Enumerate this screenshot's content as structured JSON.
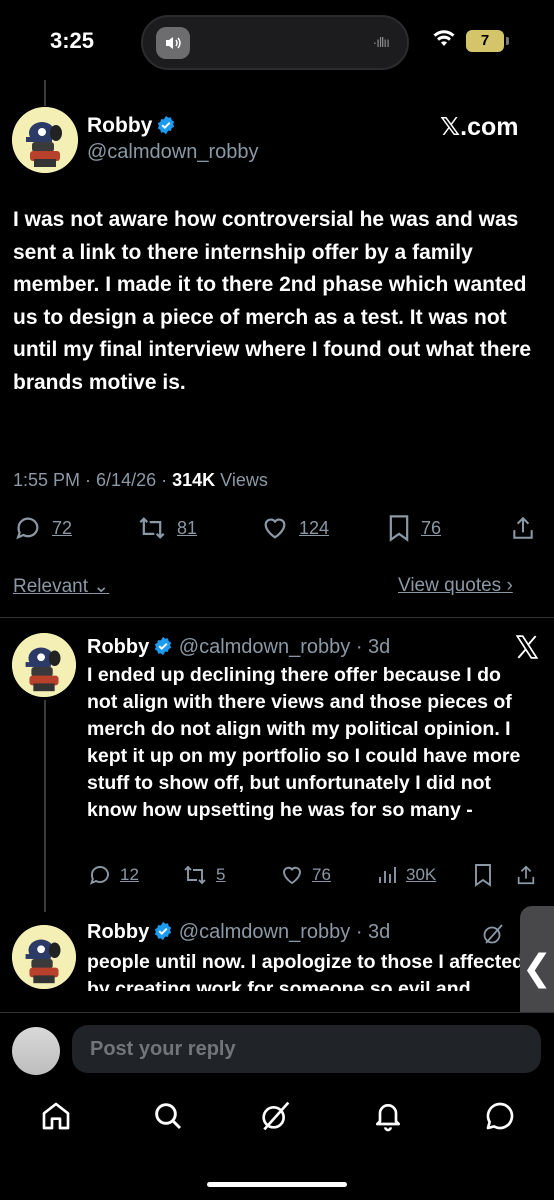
{
  "status_bar": {
    "time": "3:25",
    "battery": "7"
  },
  "main_tweet": {
    "name": "Robby",
    "handle": "@calmdown_robby",
    "source_badge": "𝕏.com",
    "text": "I was not aware how controversial he was and was sent a link to there internship offer by a family member. I made it to there 2nd phase which wanted us to design a piece of merch as a test. It was not until my final interview where I found out what there brands motive is.",
    "time": "1:55 PM",
    "date": "6/14/26",
    "views_count": "314K",
    "views_label": "Views",
    "replies": "72",
    "reposts": "81",
    "likes": "124",
    "bookmarks": "76"
  },
  "sort": {
    "relevant": "Relevant",
    "view_quotes": "View quotes"
  },
  "replies": [
    {
      "name": "Robby",
      "handle": "@calmdown_robby · 3d",
      "text": "I ended up declining there offer because I do not align with there views and those pieces of merch do not align with my political opinion. I kept it up on my portfolio so I could have more stuff to show off, but unfortunately I did not know how upsetting he was for so many -",
      "replies": "12",
      "reposts": "5",
      "likes": "76",
      "views": "30K"
    },
    {
      "name": "Robby",
      "handle": "@calmdown_robby · 3d",
      "text": "people until now. I apologize to those I affected by creating work for someone so evil and bigoted."
    }
  ],
  "reply_bar": {
    "placeholder": "Post your reply"
  },
  "colors": {
    "background": "#000000",
    "secondary_text": "#8b98a5",
    "verified": "#1d9bf0"
  },
  "icons": [
    "home-icon",
    "search-icon",
    "grok-icon",
    "notifications-icon",
    "messages-icon"
  ]
}
